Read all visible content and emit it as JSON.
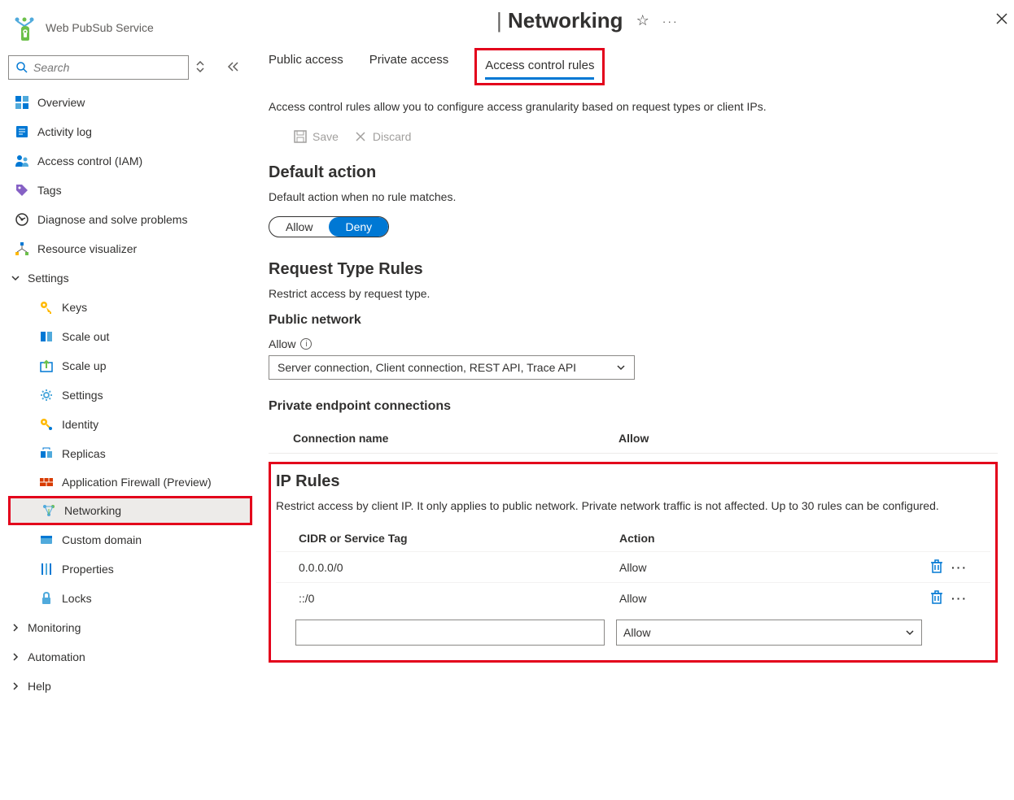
{
  "service": {
    "name": "Web PubSub Service"
  },
  "search": {
    "placeholder": "Search"
  },
  "nav": {
    "overview": "Overview",
    "activity": "Activity log",
    "iam": "Access control (IAM)",
    "tags": "Tags",
    "diagnose": "Diagnose and solve problems",
    "visualizer": "Resource visualizer",
    "settings_group": "Settings",
    "keys": "Keys",
    "scaleout": "Scale out",
    "scaleup": "Scale up",
    "settings": "Settings",
    "identity": "Identity",
    "replicas": "Replicas",
    "firewall": "Application Firewall (Preview)",
    "networking": "Networking",
    "customdomain": "Custom domain",
    "properties": "Properties",
    "locks": "Locks",
    "monitoring": "Monitoring",
    "automation": "Automation",
    "help": "Help"
  },
  "header": {
    "title": "Networking"
  },
  "tabs": {
    "public": "Public access",
    "private": "Private access",
    "acr": "Access control rules"
  },
  "acr": {
    "desc": "Access control rules allow you to configure access granularity based on request types or client IPs.",
    "save": "Save",
    "discard": "Discard",
    "default_action": {
      "title": "Default action",
      "desc": "Default action when no rule matches.",
      "allow": "Allow",
      "deny": "Deny"
    },
    "request_rules": {
      "title": "Request Type Rules",
      "desc": "Restrict access by request type.",
      "public_net": "Public network",
      "allow_label": "Allow",
      "dropdown_value": "Server connection, Client connection, REST API, Trace API",
      "private_ep": "Private endpoint connections",
      "col_name": "Connection name",
      "col_allow": "Allow"
    },
    "ip_rules": {
      "title": "IP Rules",
      "desc": "Restrict access by client IP. It only applies to public network. Private network traffic is not affected. Up to 30 rules can be configured.",
      "col_cidr": "CIDR or Service Tag",
      "col_action": "Action",
      "rows": [
        {
          "cidr": "0.0.0.0/0",
          "action": "Allow"
        },
        {
          "cidr": "::/0",
          "action": "Allow"
        }
      ],
      "new_action": "Allow"
    }
  }
}
